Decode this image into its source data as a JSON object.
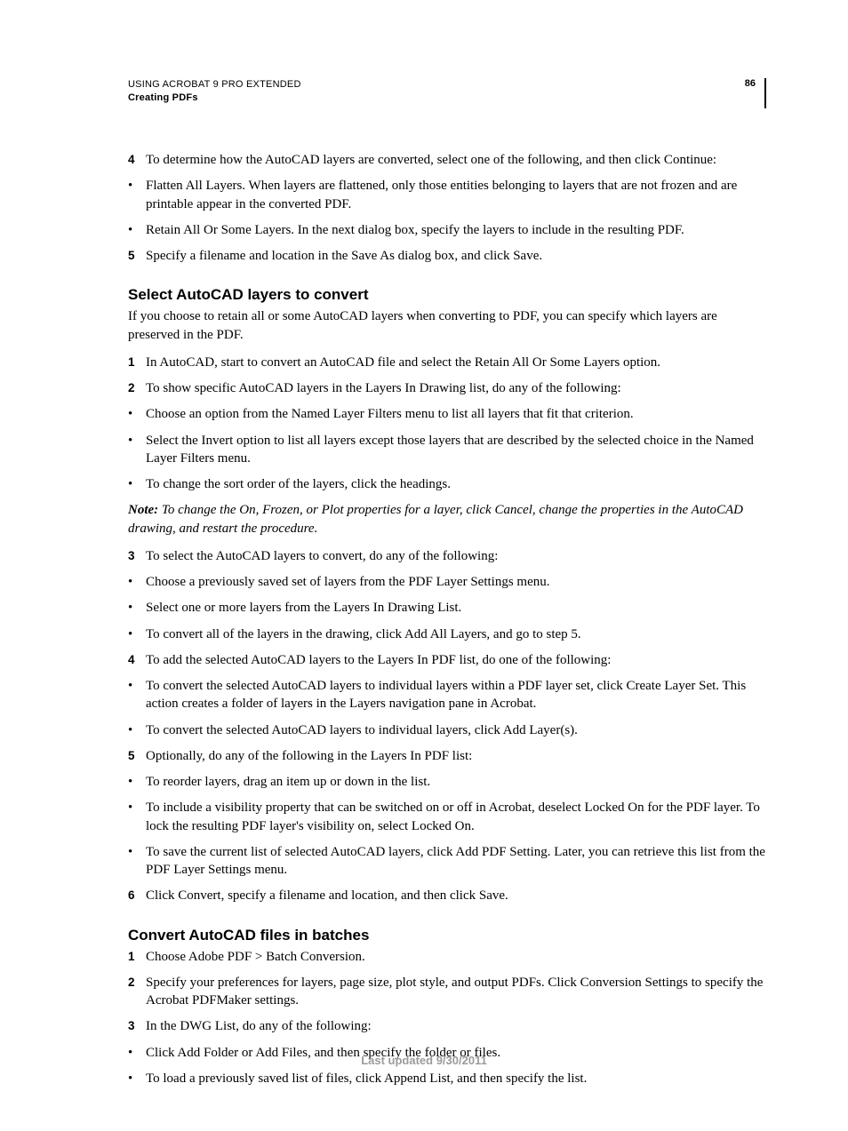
{
  "header": {
    "title": "USING ACROBAT 9 PRO EXTENDED",
    "section": "Creating PDFs",
    "pageNumber": "86"
  },
  "top": {
    "s4": "To determine how the AutoCAD layers are converted, select one of the following, and then click Continue:",
    "b1": "Flatten All Layers. When layers are flattened, only those entities belonging to layers that are not frozen and are printable appear in the converted PDF.",
    "b2": "Retain All Or Some Layers. In the next dialog box, specify the layers to include in the resulting PDF.",
    "s5": "Specify a filename and location in the Save As dialog box, and click Save."
  },
  "select": {
    "heading": "Select AutoCAD layers to convert",
    "intro": "If you choose to retain all or some AutoCAD layers when converting to PDF, you can specify which layers are preserved in the PDF.",
    "s1": "In AutoCAD, start to convert an AutoCAD file and select the Retain All Or Some Layers option.",
    "s2": "To show specific AutoCAD layers in the Layers In Drawing list, do any of the following:",
    "b2a": "Choose an option from the Named Layer Filters menu to list all layers that fit that criterion.",
    "b2b": "Select the Invert option to list all layers except those layers that are described by the selected choice in the Named Layer Filters menu.",
    "b2c": "To change the sort order of the layers, click the headings.",
    "noteLabel": "Note:",
    "noteText": " To change the On, Frozen, or Plot properties for a layer, click Cancel, change the properties in the AutoCAD drawing, and restart the procedure.",
    "s3": "To select the AutoCAD layers to convert, do any of the following:",
    "b3a": "Choose a previously saved set of layers from the PDF Layer Settings menu.",
    "b3b": "Select one or more layers from the Layers In Drawing List.",
    "b3c": "To convert all of the layers in the drawing, click Add All Layers, and go to step 5.",
    "s4": "To add the selected AutoCAD layers to the Layers In PDF list, do one of the following:",
    "b4a": "To convert the selected AutoCAD layers to individual layers within a PDF layer set, click Create Layer Set. This action creates a folder of layers in the Layers navigation pane in Acrobat.",
    "b4b": "To convert the selected AutoCAD layers to individual layers, click Add Layer(s).",
    "s5": "Optionally, do any of the following in the Layers In PDF list:",
    "b5a": "To reorder layers, drag an item up or down in the list.",
    "b5b": "To include a visibility property that can be switched on or off in Acrobat, deselect Locked On for the PDF layer. To lock the resulting PDF layer's visibility on, select Locked On.",
    "b5c": "To save the current list of selected AutoCAD layers, click Add PDF Setting. Later, you can retrieve this list from the PDF Layer Settings menu.",
    "s6": "Click Convert, specify a filename and location, and then click Save."
  },
  "batch": {
    "heading": "Convert AutoCAD files in batches",
    "s1": "Choose Adobe PDF > Batch Conversion.",
    "s2": "Specify your preferences for layers, page size, plot style, and output PDFs. Click Conversion Settings to specify the Acrobat PDFMaker settings.",
    "s3": "In the DWG List, do any of the following:",
    "b3a": "Click Add Folder or Add Files, and then specify the folder or files.",
    "b3b": "To load a previously saved list of files, click Append List, and then specify the list."
  },
  "footer": "Last updated 9/30/2011"
}
